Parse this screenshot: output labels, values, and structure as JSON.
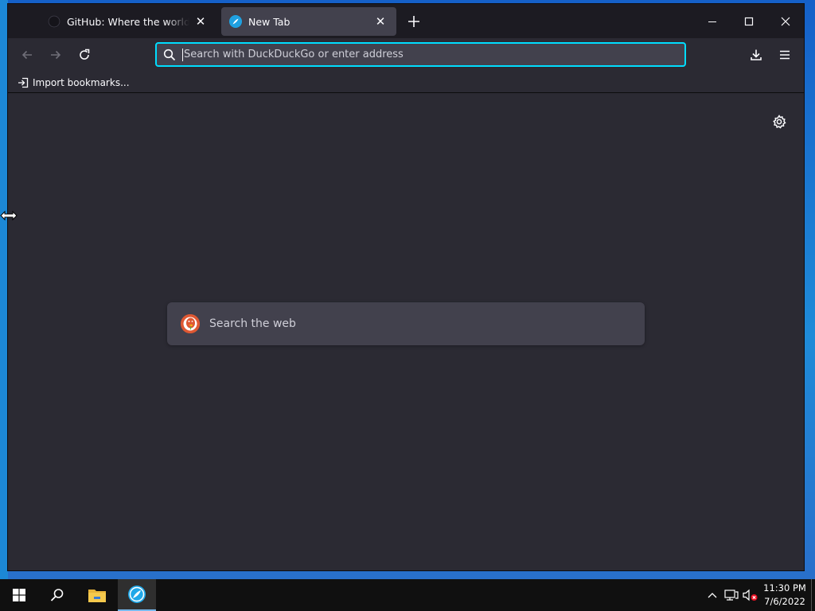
{
  "browser": {
    "tabs": [
      {
        "title": "GitHub: Where the world builds software · GitHub",
        "icon": "github-icon",
        "active": false
      },
      {
        "title": "New Tab",
        "icon": "browser-logo-icon",
        "active": true
      }
    ],
    "new_tab_icon": "plus-icon",
    "window_controls": [
      "minimize-icon",
      "maximize-icon",
      "close-icon"
    ],
    "nav": {
      "back_icon": "back-arrow-icon",
      "forward_icon": "forward-arrow-icon",
      "reload_icon": "reload-icon"
    },
    "urlbar": {
      "placeholder": "Search with DuckDuckGo or enter address",
      "value": "",
      "focused": true
    },
    "toolbar_right": [
      "download-icon",
      "hamburger-menu-icon"
    ],
    "bookmarks_bar": {
      "import_label": "Import bookmarks..."
    },
    "newtab": {
      "search_placeholder": "Search the web",
      "settings_icon": "gear-icon"
    },
    "colors": {
      "accent_focus": "#00ddff",
      "chrome_dark": "#1c1b22",
      "content_bg": "#2b2a33",
      "field_bg": "#42414d",
      "ddg_orange": "#de5833"
    }
  },
  "taskbar": {
    "items": [
      "windows-start-icon",
      "search-icon",
      "file-explorer-icon",
      "browser-icon"
    ],
    "tray": [
      "chevron-up-icon",
      "network-icon",
      "volume-muted-icon"
    ],
    "clock": {
      "time": "11:30 PM",
      "date": "7/6/2022"
    }
  }
}
